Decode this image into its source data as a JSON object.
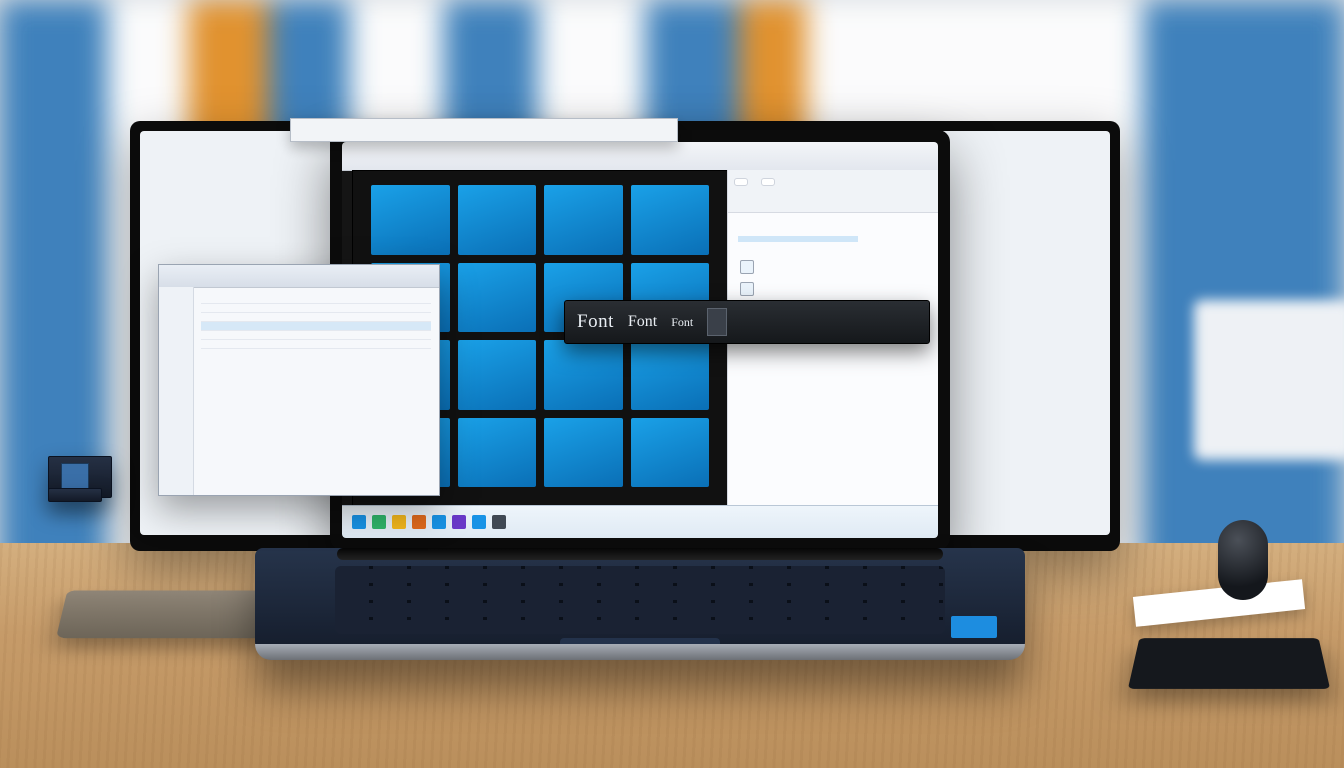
{
  "tabwin": {
    "a": "",
    "b": "",
    "c": ""
  },
  "topstrip": {
    "left": "",
    "right": ""
  },
  "ribbon": {
    "btn1": "",
    "btn2": ""
  },
  "fontbar": {
    "w1": "Font",
    "w2": "Font",
    "w3": "Font",
    "mini": ""
  },
  "rpanel": {
    "section": "",
    "items": [
      "",
      "",
      "",
      ""
    ],
    "link1": "",
    "link2": ""
  },
  "popup": {
    "title": "",
    "rows": [
      "",
      "",
      "",
      "",
      "",
      ""
    ]
  },
  "caption1": "",
  "caption2": "",
  "caption2_tail": "",
  "taskbar_colors": [
    "#1893e6",
    "#2fb56a",
    "#f3b71c",
    "#e06a1c",
    "#1893e6",
    "#6a39c9",
    "#1893e6",
    "#404954"
  ]
}
